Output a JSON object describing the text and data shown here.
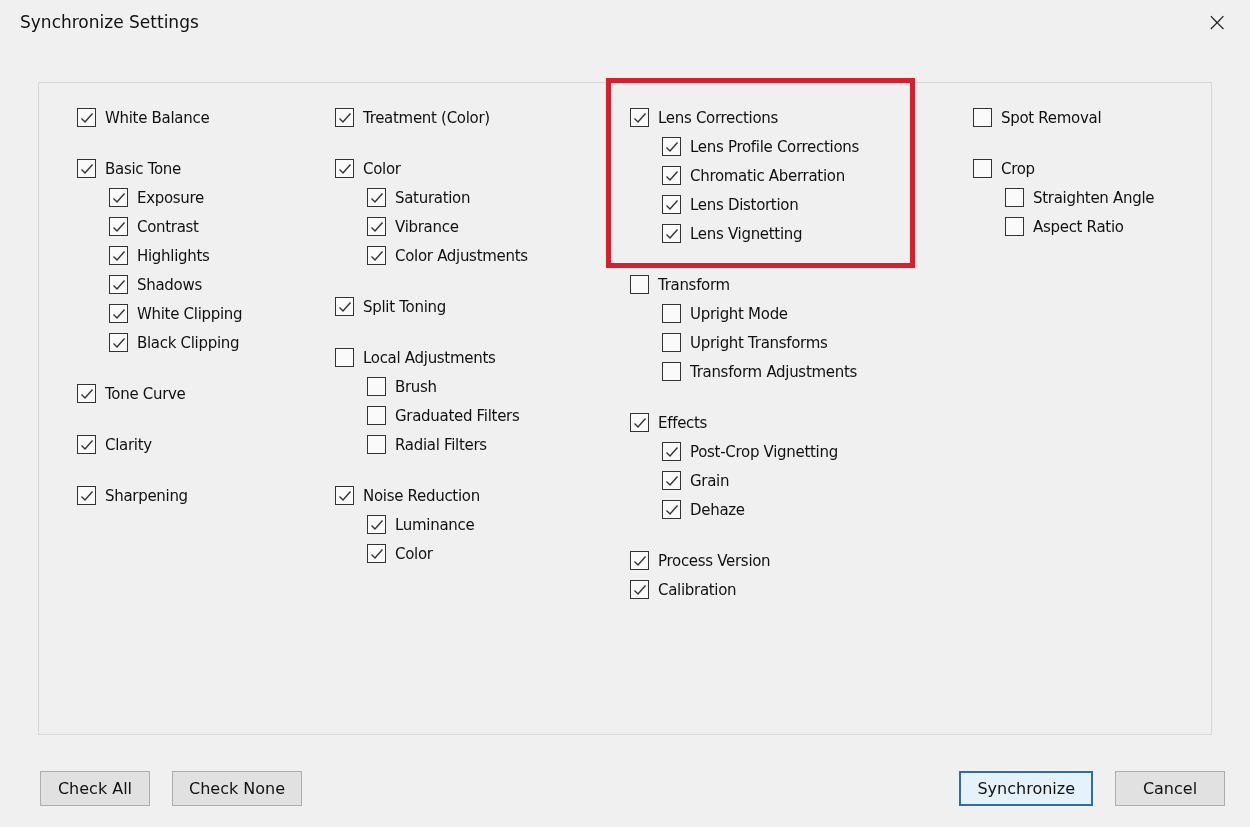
{
  "window": {
    "title": "Synchronize Settings",
    "close": "×"
  },
  "columns": [
    {
      "groups": [
        {
          "highlighted": false,
          "items": [
            {
              "label": "White Balance",
              "checked": true
            }
          ]
        },
        {
          "highlighted": false,
          "items": [
            {
              "label": "Basic Tone",
              "checked": true,
              "children": [
                {
                  "label": "Exposure",
                  "checked": true
                },
                {
                  "label": "Contrast",
                  "checked": true
                },
                {
                  "label": "Highlights",
                  "checked": true
                },
                {
                  "label": "Shadows",
                  "checked": true
                },
                {
                  "label": "White Clipping",
                  "checked": true
                },
                {
                  "label": "Black Clipping",
                  "checked": true
                }
              ]
            }
          ]
        },
        {
          "highlighted": false,
          "items": [
            {
              "label": "Tone Curve",
              "checked": true
            }
          ]
        },
        {
          "highlighted": false,
          "items": [
            {
              "label": "Clarity",
              "checked": true
            }
          ]
        },
        {
          "highlighted": false,
          "items": [
            {
              "label": "Sharpening",
              "checked": true
            }
          ]
        }
      ]
    },
    {
      "groups": [
        {
          "highlighted": false,
          "items": [
            {
              "label": "Treatment (Color)",
              "checked": true
            }
          ]
        },
        {
          "highlighted": false,
          "items": [
            {
              "label": "Color",
              "checked": true,
              "children": [
                {
                  "label": "Saturation",
                  "checked": true
                },
                {
                  "label": "Vibrance",
                  "checked": true
                },
                {
                  "label": "Color Adjustments",
                  "checked": true
                }
              ]
            }
          ]
        },
        {
          "highlighted": false,
          "items": [
            {
              "label": "Split Toning",
              "checked": true
            }
          ]
        },
        {
          "highlighted": false,
          "items": [
            {
              "label": "Local Adjustments",
              "checked": false,
              "children": [
                {
                  "label": "Brush",
                  "checked": false
                },
                {
                  "label": "Graduated Filters",
                  "checked": false
                },
                {
                  "label": "Radial Filters",
                  "checked": false
                }
              ]
            }
          ]
        },
        {
          "highlighted": false,
          "items": [
            {
              "label": "Noise Reduction",
              "checked": true,
              "children": [
                {
                  "label": "Luminance",
                  "checked": true
                },
                {
                  "label": "Color",
                  "checked": true
                }
              ]
            }
          ]
        }
      ]
    },
    {
      "groups": [
        {
          "highlighted": true,
          "items": [
            {
              "label": "Lens Corrections",
              "checked": true,
              "children": [
                {
                  "label": "Lens Profile Corrections",
                  "checked": true
                },
                {
                  "label": "Chromatic Aberration",
                  "checked": true
                },
                {
                  "label": "Lens Distortion",
                  "checked": true
                },
                {
                  "label": "Lens Vignetting",
                  "checked": true
                }
              ]
            }
          ]
        },
        {
          "highlighted": false,
          "items": [
            {
              "label": "Transform",
              "checked": false,
              "children": [
                {
                  "label": "Upright Mode",
                  "checked": false
                },
                {
                  "label": "Upright Transforms",
                  "checked": false
                },
                {
                  "label": "Transform Adjustments",
                  "checked": false
                }
              ]
            }
          ]
        },
        {
          "highlighted": false,
          "items": [
            {
              "label": "Effects",
              "checked": true,
              "children": [
                {
                  "label": "Post-Crop Vignetting",
                  "checked": true
                },
                {
                  "label": "Grain",
                  "checked": true
                },
                {
                  "label": "Dehaze",
                  "checked": true
                }
              ]
            }
          ]
        },
        {
          "highlighted": false,
          "items": [
            {
              "label": "Process Version",
              "checked": true
            },
            {
              "label": "Calibration",
              "checked": true
            }
          ]
        }
      ]
    },
    {
      "groups": [
        {
          "highlighted": false,
          "items": [
            {
              "label": "Spot Removal",
              "checked": false
            }
          ]
        },
        {
          "highlighted": false,
          "items": [
            {
              "label": "Crop",
              "checked": false,
              "children": [
                {
                  "label": "Straighten Angle",
                  "checked": false
                },
                {
                  "label": "Aspect Ratio",
                  "checked": false
                }
              ]
            }
          ]
        }
      ]
    }
  ],
  "left_buttons": [
    {
      "label": "Check All",
      "focused": false
    },
    {
      "label": "Check None",
      "focused": false
    }
  ],
  "right_buttons": [
    {
      "label": "Synchronize",
      "focused": true
    },
    {
      "label": "Cancel",
      "focused": false
    }
  ]
}
